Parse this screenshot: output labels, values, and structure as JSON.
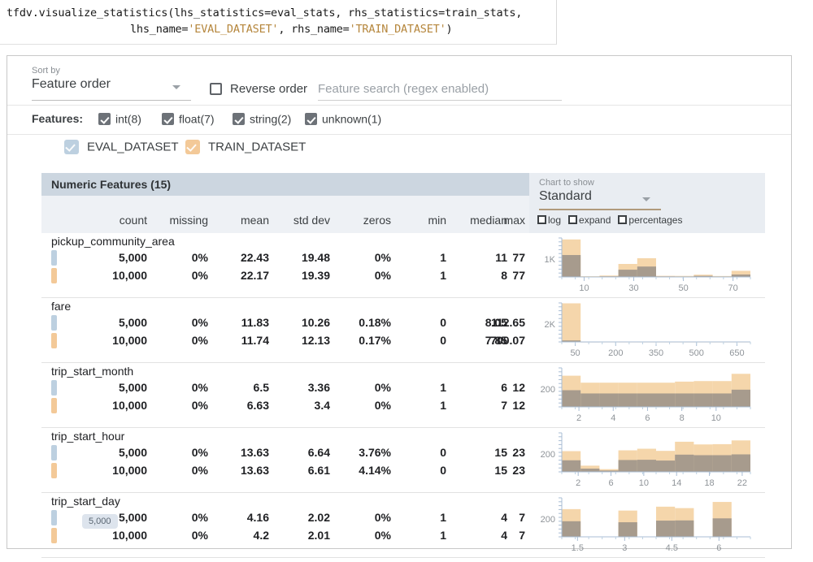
{
  "code": {
    "line1_pre": "tfdv.visualize_statistics(lhs_statistics=eval_stats, rhs_statistics=train_stats,",
    "line2_a": "lhs_name=",
    "line2_str1": "'EVAL_DATASET'",
    "line2_b": ", rhs_name=",
    "line2_str2": "'TRAIN_DATASET'",
    "line2_c": ")",
    "string_color": "#b5863c"
  },
  "controls": {
    "sort_by_label": "Sort by",
    "sort_by_value": "Feature order",
    "reverse_order_label": "Reverse order",
    "reverse_order_checked": false,
    "search_placeholder": "Feature search (regex enabled)",
    "search_value": "",
    "features_label": "Features:",
    "feature_types": [
      {
        "label": "int(8)",
        "checked": true
      },
      {
        "label": "float(7)",
        "checked": true
      },
      {
        "label": "string(2)",
        "checked": true
      },
      {
        "label": "unknown(1)",
        "checked": true
      }
    ],
    "datasets": [
      {
        "label": "EVAL_DATASET",
        "color": "#bdd0e0",
        "checked": true
      },
      {
        "label": "TRAIN_DATASET",
        "color": "#f3c998",
        "checked": true
      }
    ]
  },
  "panel": {
    "title": "Numeric Features (15)",
    "chart_to_show_label": "Chart to show",
    "chart_to_show_value": "Standard",
    "chart_options": [
      {
        "label": "log",
        "checked": false
      },
      {
        "label": "expand",
        "checked": false
      },
      {
        "label": "percentages",
        "checked": false
      }
    ],
    "columns": [
      "count",
      "missing",
      "mean",
      "std dev",
      "zeros",
      "min",
      "median",
      "max"
    ]
  },
  "tooltip": {
    "text": "5,000"
  },
  "features": [
    {
      "name": "pickup_community_area",
      "rows": [
        {
          "dataset": "EVAL_DATASET",
          "color": "#bdd0e0",
          "count": "5,000",
          "missing": "0%",
          "mean": "22.43",
          "std_dev": "19.48",
          "zeros": "0%",
          "min": "1",
          "median": "11",
          "max": "77"
        },
        {
          "dataset": "TRAIN_DATASET",
          "color": "#f3c998",
          "count": "10,000",
          "missing": "0%",
          "mean": "22.17",
          "std_dev": "19.39",
          "zeros": "0%",
          "min": "1",
          "median": "8",
          "max": "77"
        }
      ]
    },
    {
      "name": "fare",
      "rows": [
        {
          "dataset": "EVAL_DATASET",
          "color": "#bdd0e0",
          "count": "5,000",
          "missing": "0%",
          "mean": "11.83",
          "std_dev": "10.26",
          "zeros": "0.18%",
          "min": "0",
          "median": "8.05",
          "max": "112.65"
        },
        {
          "dataset": "TRAIN_DATASET",
          "color": "#f3c998",
          "count": "10,000",
          "missing": "0%",
          "mean": "11.74",
          "std_dev": "12.13",
          "zeros": "0.17%",
          "min": "0",
          "median": "7.85",
          "max": "700.07"
        }
      ]
    },
    {
      "name": "trip_start_month",
      "rows": [
        {
          "dataset": "EVAL_DATASET",
          "color": "#bdd0e0",
          "count": "5,000",
          "missing": "0%",
          "mean": "6.5",
          "std_dev": "3.36",
          "zeros": "0%",
          "min": "1",
          "median": "6",
          "max": "12"
        },
        {
          "dataset": "TRAIN_DATASET",
          "color": "#f3c998",
          "count": "10,000",
          "missing": "0%",
          "mean": "6.63",
          "std_dev": "3.4",
          "zeros": "0%",
          "min": "1",
          "median": "7",
          "max": "12"
        }
      ]
    },
    {
      "name": "trip_start_hour",
      "rows": [
        {
          "dataset": "EVAL_DATASET",
          "color": "#bdd0e0",
          "count": "5,000",
          "missing": "0%",
          "mean": "13.63",
          "std_dev": "6.64",
          "zeros": "3.76%",
          "min": "0",
          "median": "15",
          "max": "23"
        },
        {
          "dataset": "TRAIN_DATASET",
          "color": "#f3c998",
          "count": "10,000",
          "missing": "0%",
          "mean": "13.63",
          "std_dev": "6.61",
          "zeros": "4.14%",
          "min": "0",
          "median": "15",
          "max": "23"
        }
      ]
    },
    {
      "name": "trip_start_day",
      "rows": [
        {
          "dataset": "EVAL_DATASET",
          "color": "#bdd0e0",
          "count": "5,000",
          "missing": "0%",
          "mean": "4.16",
          "std_dev": "2.02",
          "zeros": "0%",
          "min": "1",
          "median": "4",
          "max": "7"
        },
        {
          "dataset": "TRAIN_DATASET",
          "color": "#f3c998",
          "count": "10,000",
          "missing": "0%",
          "mean": "4.2",
          "std_dev": "2.01",
          "zeros": "0%",
          "min": "1",
          "median": "4",
          "max": "7"
        }
      ]
    }
  ],
  "chart_data": [
    {
      "type": "bar",
      "feature": "pickup_community_area",
      "title": "",
      "xlabel": "",
      "ylabel": "",
      "ytick_label": "1K",
      "xticks": [
        "10",
        "30",
        "50",
        "70"
      ],
      "xtick_positions": [
        10,
        30,
        50,
        70
      ],
      "xlim": [
        1,
        77
      ],
      "ylim": [
        0,
        2100
      ],
      "grid": false,
      "legend": "none",
      "series": [
        {
          "name": "TRAIN_DATASET",
          "color": "#f5d6ab",
          "bins": [
            1,
            8.6,
            16.2,
            23.8,
            31.4,
            39,
            46.6,
            54.2,
            61.8,
            69.4,
            77
          ],
          "values": [
            2020,
            40,
            75,
            700,
            1010,
            60,
            55,
            120,
            50,
            330
          ]
        },
        {
          "name": "EVAL_DATASET_overlap",
          "color": "#a79b8d",
          "bins": [
            1,
            8.6,
            16.2,
            23.8,
            31.4,
            39,
            46.6,
            54.2,
            61.8,
            69.4,
            77
          ],
          "values": [
            1180,
            20,
            35,
            390,
            560,
            30,
            25,
            60,
            25,
            130
          ]
        }
      ]
    },
    {
      "type": "bar",
      "feature": "fare",
      "ytick_label": "2K",
      "xticks": [
        "50",
        "200",
        "350",
        "500",
        "650"
      ],
      "xtick_positions": [
        50,
        200,
        350,
        500,
        650
      ],
      "xlim": [
        0,
        700
      ],
      "ylim": [
        0,
        10000
      ],
      "grid": false,
      "legend": "none",
      "series": [
        {
          "name": "TRAIN_DATASET",
          "color": "#f5d6ab",
          "bins": [
            0,
            70,
            140,
            210,
            280,
            350,
            420,
            490,
            560,
            630,
            700
          ],
          "values": [
            9900,
            20,
            6,
            3,
            2,
            2,
            1,
            1,
            1,
            2
          ]
        },
        {
          "name": "EVAL_DATASET_overlap",
          "color": "#a79b8d",
          "bins": [
            0,
            70,
            140,
            210,
            280,
            350,
            420,
            490,
            560,
            630,
            700
          ],
          "values": [
            380,
            5,
            0,
            0,
            0,
            0,
            0,
            0,
            0,
            0
          ]
        }
      ]
    },
    {
      "type": "bar",
      "feature": "trip_start_month",
      "ytick_label": "200",
      "xticks": [
        "2",
        "4",
        "6",
        "8",
        "10"
      ],
      "xtick_positions": [
        2,
        4,
        6,
        8,
        10
      ],
      "xlim": [
        1,
        12
      ],
      "ylim": [
        0,
        1450
      ],
      "grid": false,
      "legend": "none",
      "series": [
        {
          "name": "TRAIN_DATASET",
          "color": "#f5d6ab",
          "bins": [
            1,
            2.1,
            3.2,
            4.3,
            5.4,
            6.5,
            7.6,
            8.7,
            9.8,
            10.9,
            12
          ],
          "values": [
            1160,
            900,
            900,
            900,
            900,
            900,
            940,
            960,
            960,
            1230
          ]
        },
        {
          "name": "EVAL_DATASET_overlap",
          "color": "#a79b8d",
          "bins": [
            1,
            2.1,
            3.2,
            4.3,
            5.4,
            6.5,
            7.6,
            8.7,
            9.8,
            10.9,
            12
          ],
          "values": [
            620,
            500,
            500,
            500,
            500,
            500,
            500,
            500,
            500,
            640
          ]
        }
      ]
    },
    {
      "type": "bar",
      "feature": "trip_start_hour",
      "ytick_label": "200",
      "xticks": [
        "2",
        "6",
        "10",
        "14",
        "18",
        "22"
      ],
      "xtick_positions": [
        2,
        6,
        10,
        14,
        18,
        22
      ],
      "xlim": [
        0,
        23
      ],
      "ylim": [
        0,
        1450
      ],
      "grid": false,
      "legend": "none",
      "series": [
        {
          "name": "TRAIN_DATASET",
          "color": "#f5d6ab",
          "bins": [
            0,
            2.3,
            4.6,
            6.9,
            9.2,
            11.5,
            13.8,
            16.1,
            18.4,
            20.7,
            23
          ],
          "values": [
            770,
            230,
            100,
            800,
            860,
            780,
            1120,
            1020,
            1030,
            1170
          ]
        },
        {
          "name": "EVAL_DATASET_overlap",
          "color": "#a79b8d",
          "bins": [
            0,
            2.3,
            4.6,
            6.9,
            9.2,
            11.5,
            13.8,
            16.1,
            18.4,
            20.7,
            23
          ],
          "values": [
            430,
            120,
            50,
            440,
            450,
            420,
            640,
            620,
            620,
            650
          ]
        }
      ]
    },
    {
      "type": "bar",
      "feature": "trip_start_day",
      "ytick_label": "200",
      "xticks": [
        "1.5",
        "3",
        "4.5",
        "6"
      ],
      "xtick_positions": [
        1.5,
        3,
        4.5,
        6
      ],
      "xlim": [
        1,
        7
      ],
      "ylim": [
        0,
        1900
      ],
      "grid": false,
      "legend": "none",
      "series": [
        {
          "name": "TRAIN_DATASET",
          "color": "#f5d6ab",
          "bins": [
            1,
            1.6,
            2.2,
            2.8,
            3.4,
            4.0,
            4.6,
            5.2,
            5.8,
            6.4,
            7
          ],
          "values": [
            1350,
            0,
            0,
            1280,
            0,
            1470,
            1400,
            0,
            1700,
            0
          ]
        },
        {
          "name": "EVAL_DATASET_overlap",
          "color": "#a79b8d",
          "bins": [
            1,
            1.6,
            2.2,
            2.8,
            3.4,
            4.0,
            4.6,
            5.2,
            5.8,
            6.4,
            7
          ],
          "values": [
            760,
            0,
            0,
            710,
            0,
            790,
            800,
            0,
            900,
            0
          ]
        }
      ]
    }
  ]
}
